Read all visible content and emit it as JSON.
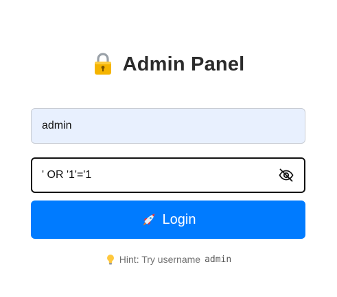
{
  "header": {
    "icon": "lock-icon",
    "title": "Admin Panel"
  },
  "form": {
    "username": {
      "value": "admin"
    },
    "password": {
      "value": "' OR '1'='1",
      "toggle_icon": "eye-slash-icon"
    },
    "login_button": {
      "icon": "rocket-icon",
      "label": "Login"
    }
  },
  "hint": {
    "icon": "lightbulb-icon",
    "text": "Hint: Try username",
    "code": "admin"
  },
  "colors": {
    "accent": "#007bff",
    "username_background": "#e8f0fe",
    "title_text": "#2b2b2b",
    "hint_text": "#6f6f6f"
  }
}
